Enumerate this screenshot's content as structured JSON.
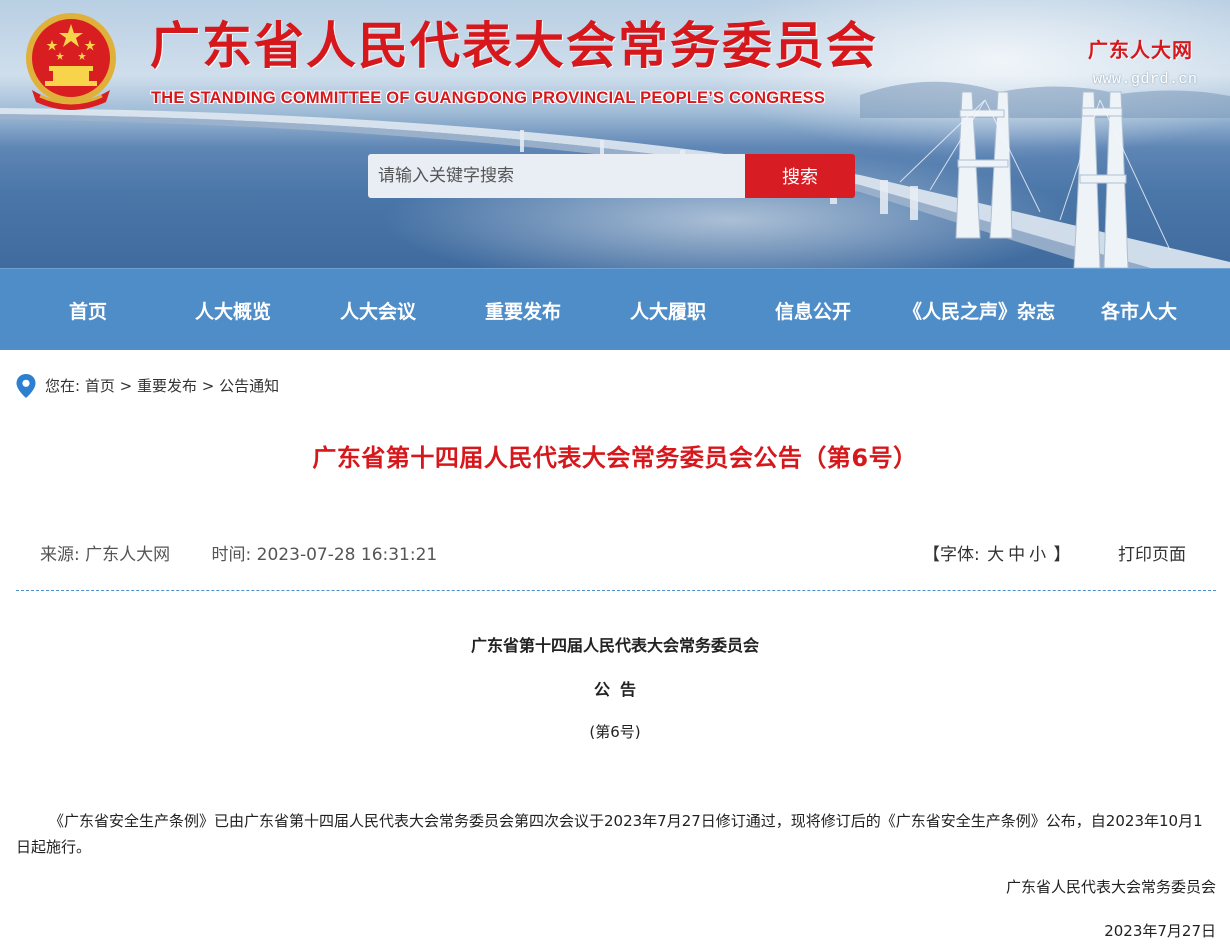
{
  "header": {
    "title_cn": "广东省人民代表大会常务委员会",
    "title_en": "THE STANDING COMMITTEE OF GUANGDONG PROVINCIAL PEOPLE’S CONGRESS",
    "site_name": "广东人大网",
    "site_url": "www.gdrd.cn",
    "search_placeholder": "请输入关键字搜索",
    "search_button": "搜索",
    "emblem_icon": "national-emblem-icon"
  },
  "nav": {
    "items": [
      {
        "label": "首页"
      },
      {
        "label": "人大概览"
      },
      {
        "label": "人大会议"
      },
      {
        "label": "重要发布"
      },
      {
        "label": "人大履职"
      },
      {
        "label": "信息公开"
      },
      {
        "label": "《人民之声》杂志"
      },
      {
        "label": "各市人大"
      }
    ]
  },
  "breadcrumb": {
    "prefix": "您在: ",
    "items": [
      {
        "label": "首页"
      },
      {
        "label": "重要发布"
      },
      {
        "label": "公告通知"
      }
    ],
    "separator": " > "
  },
  "article": {
    "title": "广东省第十四届人民代表大会常务委员会公告（第6号）",
    "source": "来源: 广东人大网",
    "time": "时间: 2023-07-28 16:31:21",
    "font_label_open": "【字体: ",
    "font_sizes": [
      "大",
      "中",
      "小"
    ],
    "font_label_close": " 】",
    "print": "打印页面",
    "doc_heading": "广东省第十四届人民代表大会常务委员会",
    "doc_type": "公告",
    "doc_number": "(第6号)",
    "body": "《广东省安全生产条例》已由广东省第十四届人民代表大会常务委员会第四次会议于2023年7月27日修订通过，现将修订后的《广东省安全生产条例》公布，自2023年10月1日起施行。",
    "signature": "广东省人民代表大会常务委员会",
    "date": "2023年7月27日"
  },
  "colors": {
    "brand_red": "#d6181c",
    "nav_blue": "#4f8dc8",
    "search_red": "#d71c24"
  }
}
